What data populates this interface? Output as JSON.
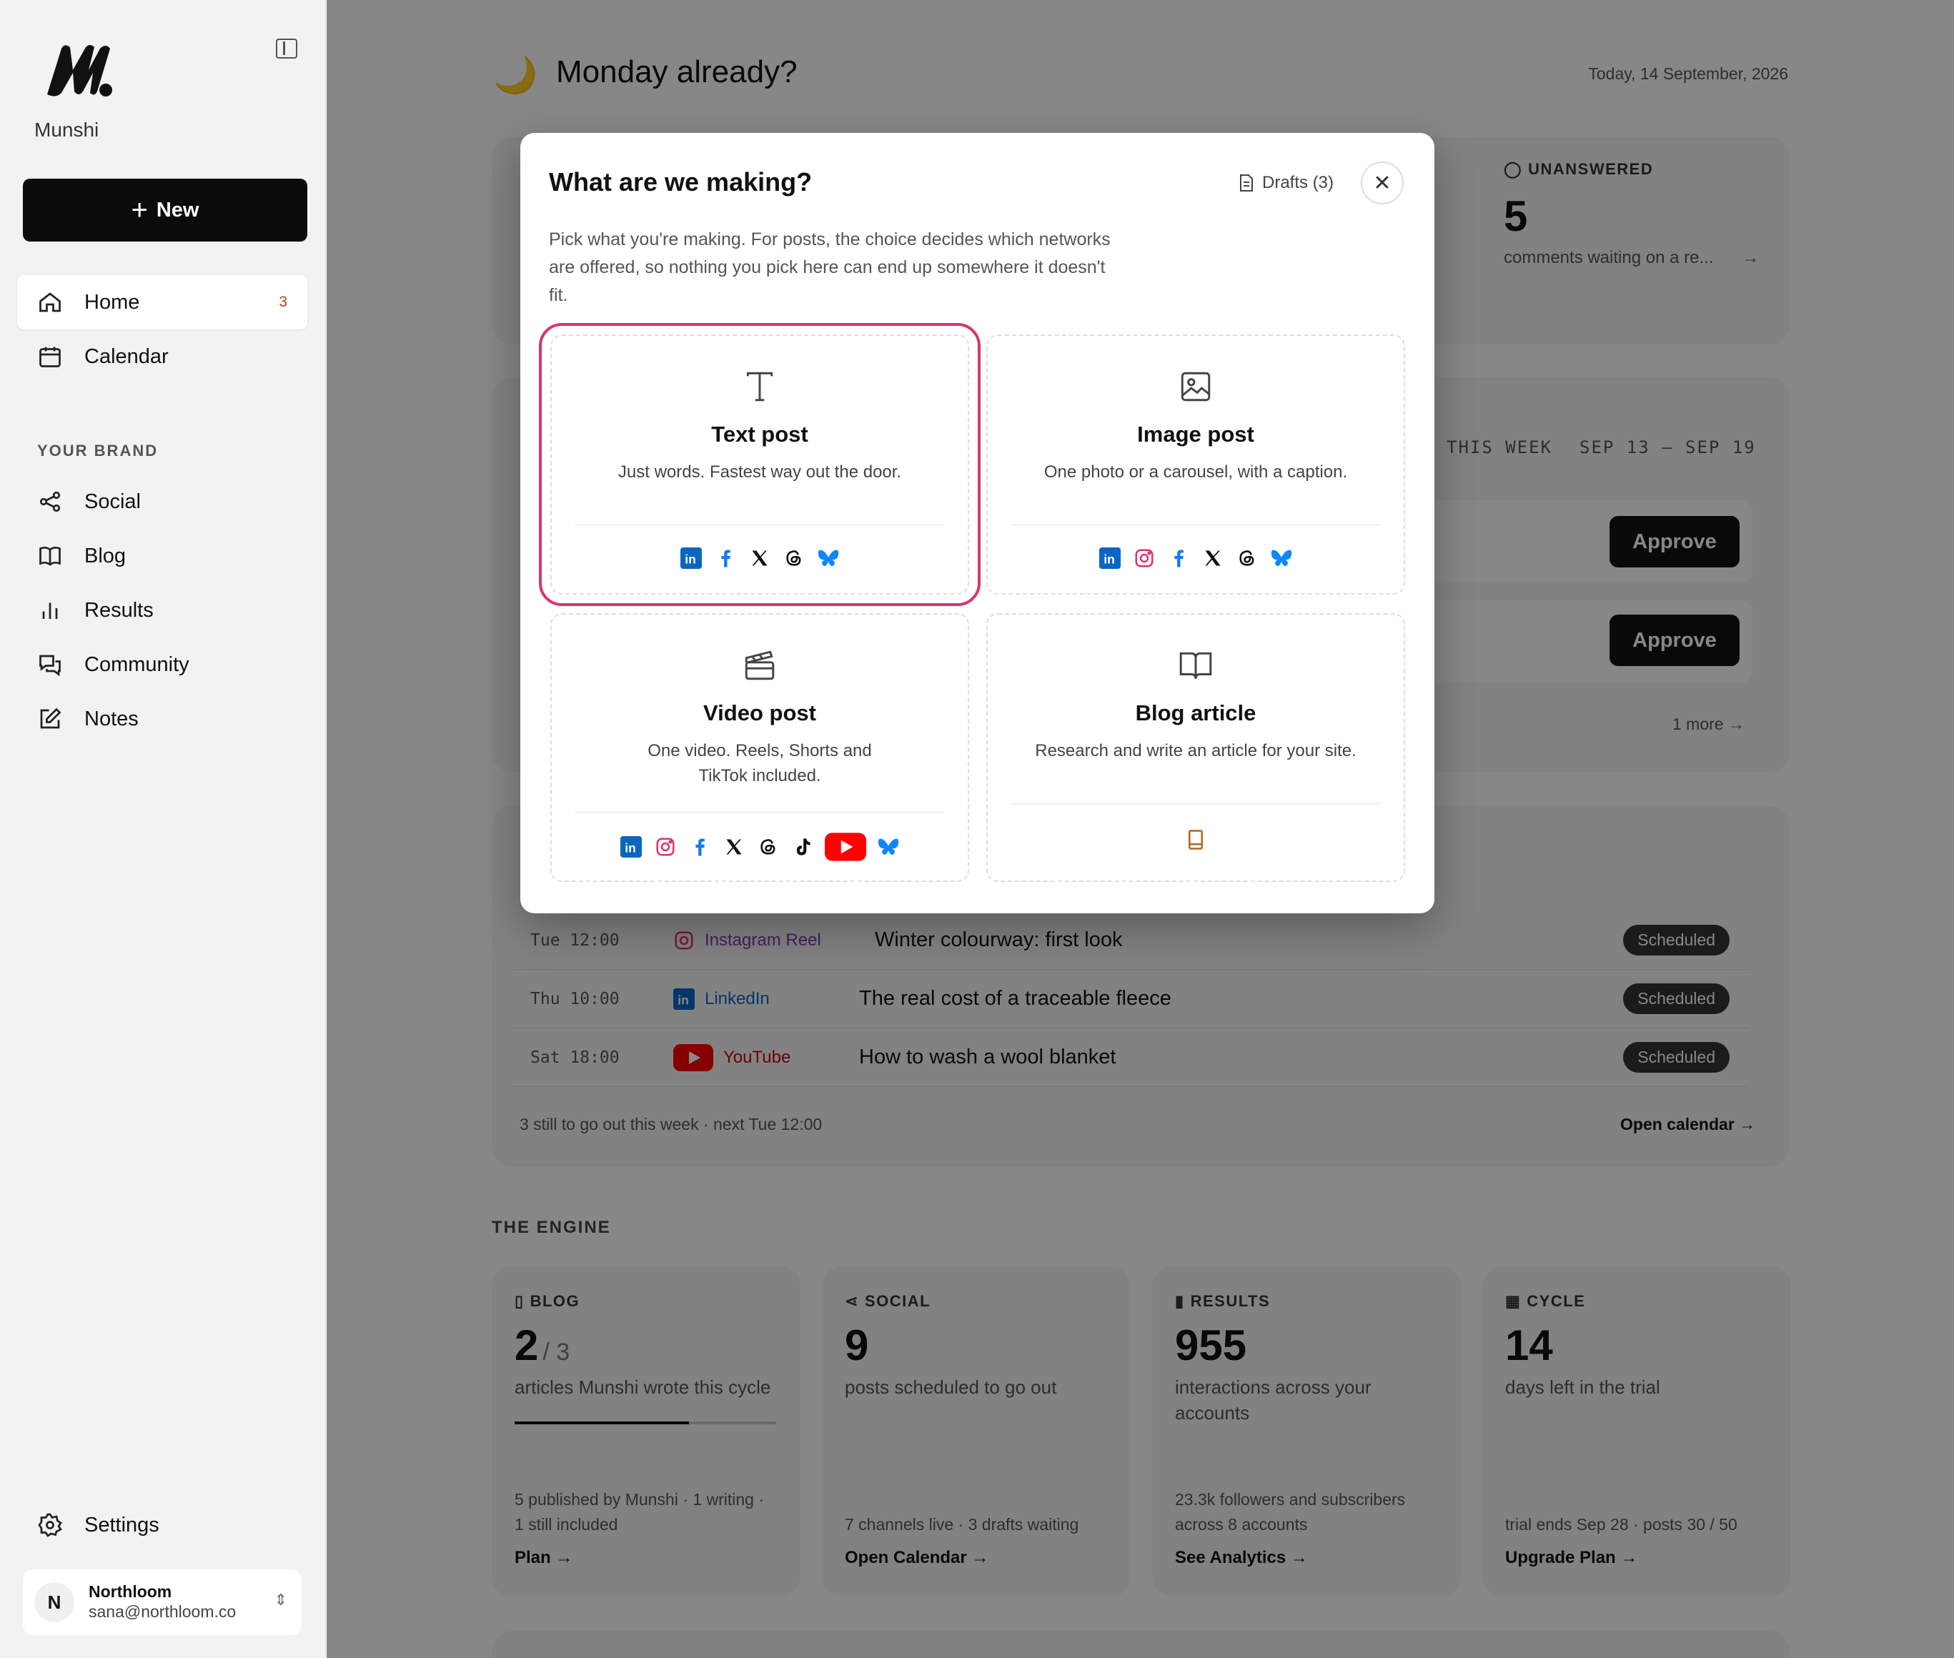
{
  "sidebar": {
    "brand": "Munshi",
    "new_label": "New",
    "nav": [
      {
        "label": "Home",
        "badge": "3"
      },
      {
        "label": "Calendar"
      }
    ],
    "section_label": "YOUR BRAND",
    "brand_nav": [
      {
        "label": "Social"
      },
      {
        "label": "Blog"
      },
      {
        "label": "Results"
      },
      {
        "label": "Community"
      },
      {
        "label": "Notes"
      }
    ],
    "settings_label": "Settings",
    "account": {
      "initial": "N",
      "name": "Northloom",
      "email": "sana@northloom.co"
    }
  },
  "main": {
    "greeting": "Monday already?",
    "greeting_emoji": "🌙",
    "date": "Today, 14 September, 2026",
    "unanswered": {
      "label": "UNANSWERED",
      "count": "5",
      "desc": "comments waiting on a re...",
      "arrow": "→"
    },
    "week": {
      "label": "THIS WEEK",
      "range": "SEP 13 – SEP 19",
      "approve_label": "Approve",
      "more": "1 more →"
    },
    "schedule": [
      {
        "time": "Tue 12:00",
        "network": "Instagram Reel",
        "title": "Winter colourway: first look",
        "status": "Scheduled"
      },
      {
        "time": "Thu 10:00",
        "network": "LinkedIn",
        "title": "The real cost of a traceable fleece",
        "status": "Scheduled"
      },
      {
        "time": "Sat 18:00",
        "network": "YouTube",
        "title": "How to wash a wool blanket",
        "status": "Scheduled"
      }
    ],
    "schedule_footer": "3 still to go out this week · next Tue 12:00",
    "open_calendar": "Open calendar →",
    "engine_title": "THE ENGINE",
    "engine": [
      {
        "label": "BLOG",
        "num": "2",
        "sub": "/ 3",
        "desc": "articles Munshi wrote this cycle",
        "foot": "5 published by Munshi · 1 writing · 1 still included",
        "link": "Plan →",
        "progress": 0.667
      },
      {
        "label": "SOCIAL",
        "num": "9",
        "desc": "posts scheduled to go out",
        "foot": "7 channels live · 3 drafts waiting",
        "link": "Open Calendar →"
      },
      {
        "label": "RESULTS",
        "num": "955",
        "desc": "interactions across your accounts",
        "foot": "23.3k followers and subscribers across 8 accounts",
        "link": "See Analytics →"
      },
      {
        "label": "CYCLE",
        "num": "14",
        "desc": "days left in the trial",
        "foot": "trial ends Sep 28 · posts 30 / 50",
        "link": "Upgrade Plan →"
      }
    ]
  },
  "modal": {
    "title": "What are we making?",
    "drafts": "Drafts (3)",
    "description": "Pick what you're making. For posts, the choice decides which networks are offered, so nothing you pick here can end up somewhere it doesn't fit.",
    "options": [
      {
        "title": "Text post",
        "desc": "Just words. Fastest way out the door.",
        "networks": [
          "linkedin",
          "facebook",
          "x",
          "threads",
          "bluesky"
        ]
      },
      {
        "title": "Image post",
        "desc": "One photo or a carousel, with a caption.",
        "networks": [
          "linkedin",
          "instagram",
          "facebook",
          "x",
          "threads",
          "bluesky"
        ]
      },
      {
        "title": "Video post",
        "desc": "One video. Reels, Shorts and TikTok included.",
        "networks": [
          "linkedin",
          "instagram",
          "facebook",
          "x",
          "threads",
          "tiktok",
          "youtube",
          "bluesky"
        ]
      },
      {
        "title": "Blog article",
        "desc": "Research and write an article for your site.",
        "networks": [
          "blog"
        ]
      }
    ]
  },
  "colors": {
    "accent_selected": "#d9366a",
    "linkedin": "#0a66c2",
    "instagram": "#e1306c",
    "facebook": "#1877f2",
    "youtube": "#ff0000",
    "bluesky": "#1185fe"
  }
}
